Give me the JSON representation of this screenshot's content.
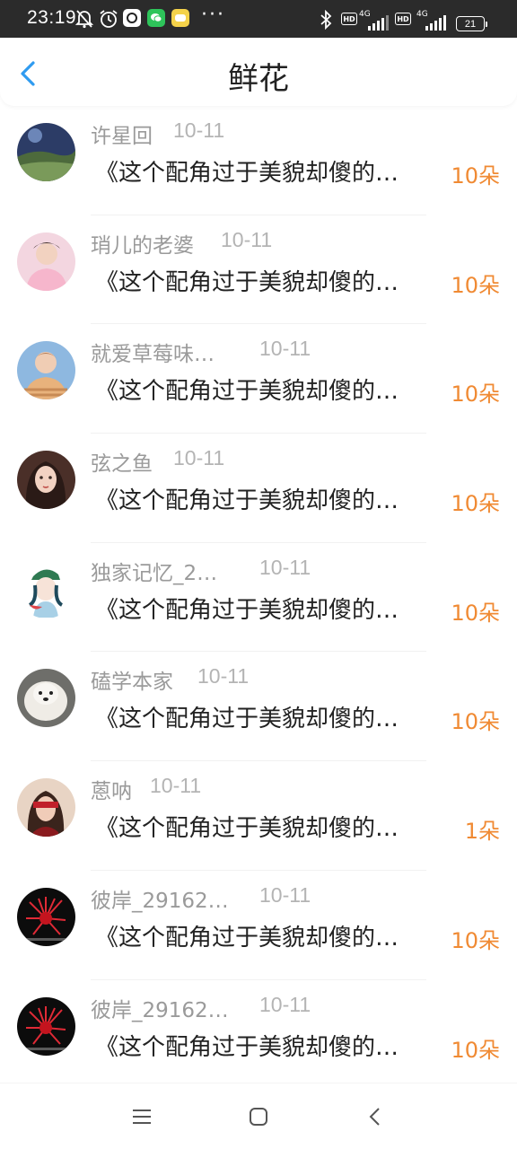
{
  "status_bar": {
    "time": "23:19",
    "hd1": "HD",
    "net1": "4G",
    "hd2": "HD",
    "net2": "4G",
    "battery": "21",
    "more": "···"
  },
  "header": {
    "title": "鲜花"
  },
  "colors": {
    "accent_orange": "#f08a33",
    "back_blue": "#2f9bf0"
  },
  "items": [
    {
      "name": "许星回",
      "date": "10-11",
      "book": "《这个配角过于美貌却傻的…",
      "flowers": "10朵"
    },
    {
      "name": "琑儿的老婆",
      "date": "10-11",
      "book": "《这个配角过于美貌却傻的…",
      "flowers": "10朵"
    },
    {
      "name": "就爱草莓味…",
      "date": "10-11",
      "book": "《这个配角过于美貌却傻的…",
      "flowers": "10朵"
    },
    {
      "name": "弦之鱼",
      "date": "10-11",
      "book": "《这个配角过于美貌却傻的…",
      "flowers": "10朵"
    },
    {
      "name": "独家记忆_2…",
      "date": "10-11",
      "book": "《这个配角过于美貌却傻的…",
      "flowers": "10朵"
    },
    {
      "name": "磕学本家",
      "date": "10-11",
      "book": "《这个配角过于美貌却傻的…",
      "flowers": "10朵"
    },
    {
      "name": "蒽呐",
      "date": "10-11",
      "book": "《这个配角过于美貌却傻的…",
      "flowers": "1朵"
    },
    {
      "name": "彼岸_29162…",
      "date": "10-11",
      "book": "《这个配角过于美貌却傻的…",
      "flowers": "10朵"
    },
    {
      "name": "彼岸_29162…",
      "date": "10-11",
      "book": "《这个配角过于美貌却傻的…",
      "flowers": "10朵"
    }
  ],
  "nav_icons": [
    "menu-icon",
    "home-icon",
    "back-icon"
  ]
}
